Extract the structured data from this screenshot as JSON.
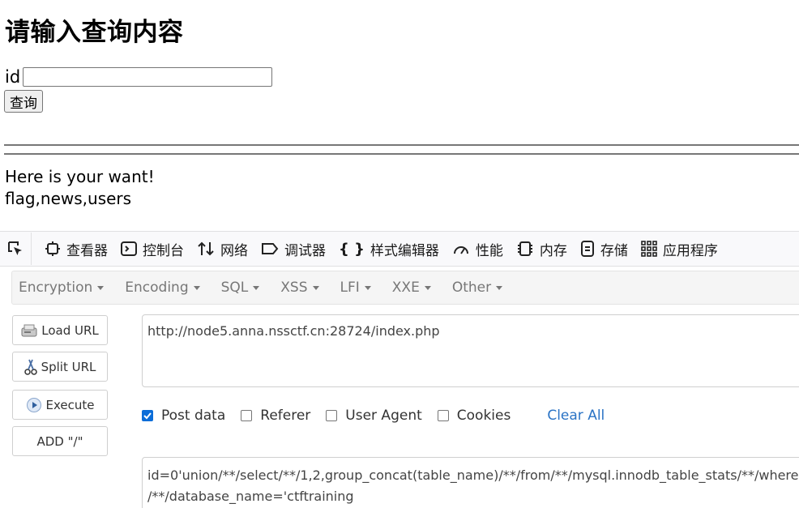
{
  "page": {
    "title": "请输入查询内容",
    "id_label": "id",
    "id_value": "",
    "query_button": "查询",
    "result_line1": "Here is your want!",
    "result_line2": "flag,news,users"
  },
  "devtools": {
    "tabs": [
      {
        "label": "查看器",
        "icon": "inspector-icon"
      },
      {
        "label": "控制台",
        "icon": "console-icon"
      },
      {
        "label": "网络",
        "icon": "network-icon"
      },
      {
        "label": "调试器",
        "icon": "debugger-icon"
      },
      {
        "label": "样式编辑器",
        "icon": "style-editor-icon"
      },
      {
        "label": "性能",
        "icon": "performance-icon"
      },
      {
        "label": "内存",
        "icon": "memory-icon"
      },
      {
        "label": "存储",
        "icon": "storage-icon"
      },
      {
        "label": "应用程序",
        "icon": "application-icon"
      }
    ]
  },
  "hackbar": {
    "menu": [
      "Encryption",
      "Encoding",
      "SQL",
      "XSS",
      "LFI",
      "XXE",
      "Other"
    ],
    "buttons": {
      "load_url": "Load URL",
      "split_url": "Split URL",
      "execute": "Execute",
      "add_slash": "ADD \"/\""
    },
    "url": "http://node5.anna.nssctf.cn:28724/index.php",
    "options": {
      "post_data": {
        "label": "Post data",
        "checked": true
      },
      "referer": {
        "label": "Referer",
        "checked": false
      },
      "user_agent": {
        "label": "User Agent",
        "checked": false
      },
      "cookies": {
        "label": "Cookies",
        "checked": false
      }
    },
    "clear_all": "Clear All",
    "post_line1": "id=0'union/**/select/**/1,2,group_concat(table_name)/**/from/**/mysql.innodb_table_stats/**/where",
    "post_line2": "/**/database_name='ctftraining"
  },
  "colors": {
    "accent": "#0b6dd8",
    "link": "#2a73c5"
  }
}
